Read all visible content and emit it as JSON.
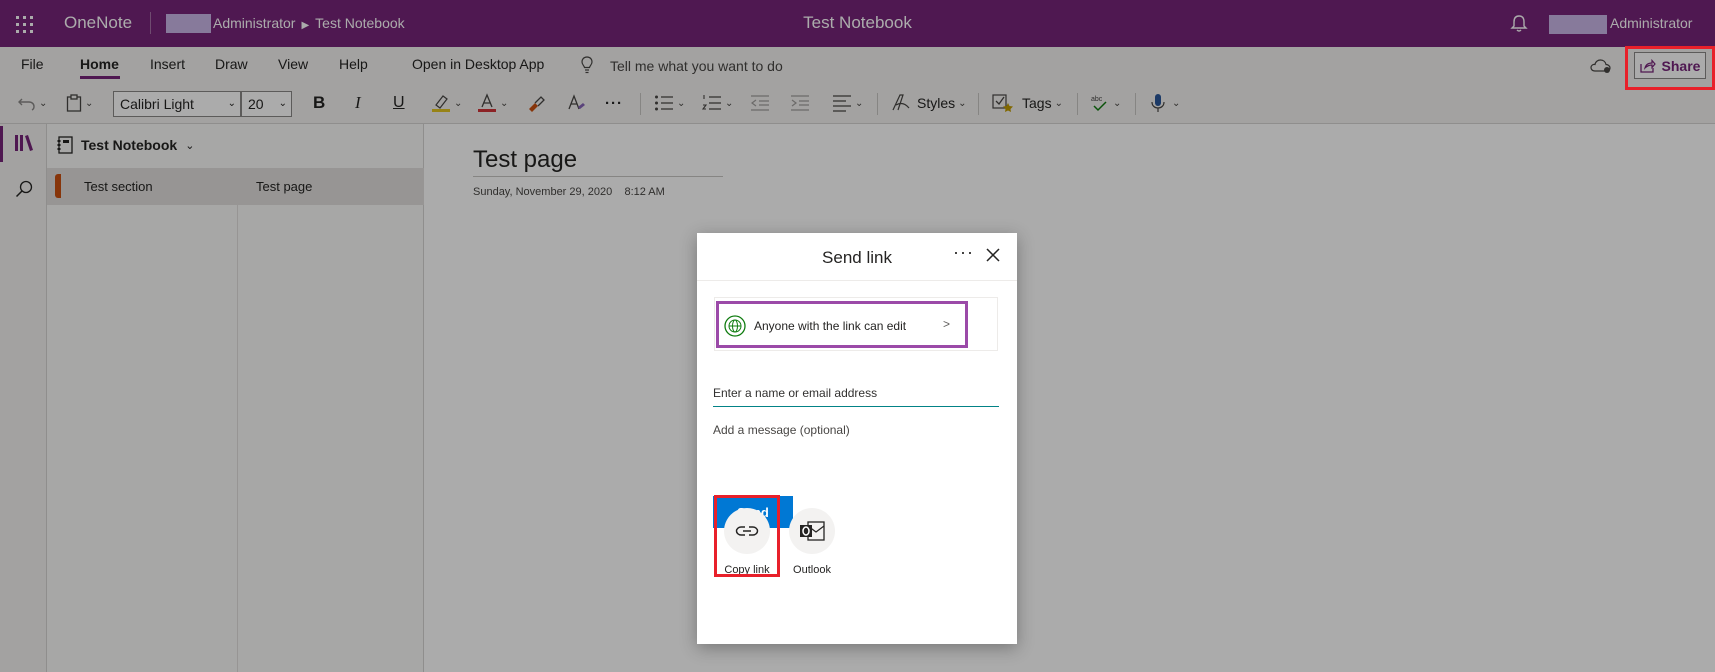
{
  "topbar": {
    "app_name": "OneNote",
    "breadcrumb_user": "Administrator",
    "breadcrumb_notebook": "Test Notebook",
    "doc_title": "Test Notebook",
    "user_name": "Administrator",
    "bg_color": "#77257a"
  },
  "ribbon": {
    "menu": [
      "File",
      "Home",
      "Insert",
      "Draw",
      "View",
      "Help"
    ],
    "active_menu": "Home",
    "open_desktop": "Open in Desktop App",
    "tell_me": "Tell me what you want to do",
    "share_label": "Share",
    "font_name": "Calibri Light",
    "font_size": "20",
    "bold": "B",
    "italic": "I",
    "underline": "U",
    "more": "···",
    "styles_label": "Styles",
    "tags_label": "Tags"
  },
  "nav": {
    "notebook": "Test Notebook",
    "section": "Test section",
    "page": "Test page"
  },
  "page": {
    "title": "Test page",
    "date": "Sunday, November 29, 2020",
    "time": "8:12 AM"
  },
  "dialog": {
    "title": "Send link",
    "more": "···",
    "permission": "Anyone with the link can edit",
    "email_placeholder": "Enter a name or email address",
    "message_placeholder": "Add a message (optional)",
    "send_label": "Send",
    "copy_link_label": "Copy link",
    "outlook_label": "Outlook"
  },
  "colors": {
    "accent": "#77257a",
    "send_button": "#0078d4",
    "highlight_red": "#e8202a",
    "highlight_purple": "#9b4aa8",
    "section_color": "#ca5010"
  }
}
